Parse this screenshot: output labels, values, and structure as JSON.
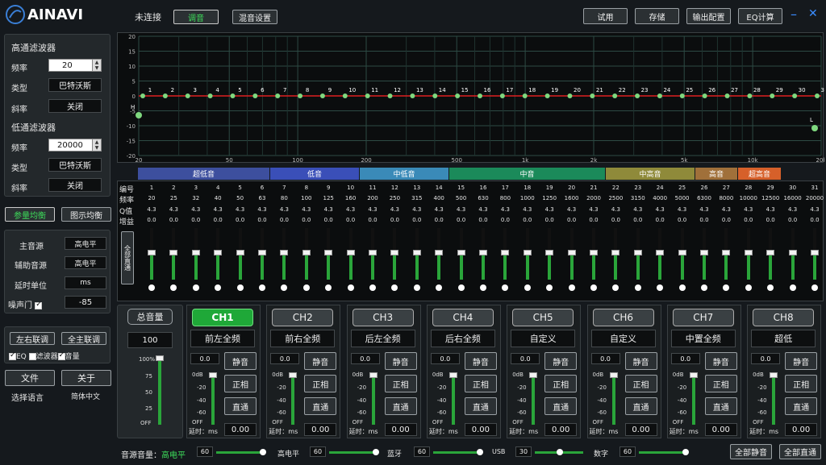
{
  "app": {
    "logo": "AINAVI",
    "status": "未连接",
    "tab1": "调音",
    "tab2": "混音设置"
  },
  "top_buttons": [
    "试用",
    "存储",
    "输出配置",
    "EQ计算"
  ],
  "hp": {
    "title": "高通滤波器",
    "freq_label": "频率",
    "freq": "20",
    "type_label": "类型",
    "type": "巴特沃斯",
    "slope_label": "斜率",
    "slope": "关闭"
  },
  "lp": {
    "title": "低通滤波器",
    "freq_label": "频率",
    "freq": "20000",
    "type_label": "类型",
    "type": "巴特沃斯",
    "slope_label": "斜率",
    "slope": "关闭"
  },
  "eq_mode": {
    "param": "参量均衡",
    "graphic": "图示均衡"
  },
  "source": {
    "main_label": "主音源",
    "main": "高电平",
    "aux_label": "辅助音源",
    "aux": "高电平",
    "delay_label": "延时单位",
    "delay": "ms",
    "noise_label": "噪声门",
    "noise": "-85"
  },
  "link": {
    "lr": "左右联调",
    "all": "全主联调",
    "eq": "EQ",
    "filter": "滤波器",
    "volume": "音量"
  },
  "file": {
    "file": "文件",
    "about": "关于",
    "lang": "选择语言",
    "sub": "简体中文"
  },
  "graph": {
    "y_ticks": [
      "20",
      "15",
      "10",
      "5",
      "0",
      "-5",
      "-10",
      "-15",
      "-20"
    ],
    "x_ticks": [
      "20",
      "50",
      "100",
      "200",
      "500",
      "1k",
      "2k",
      "5k",
      "10k",
      "20k"
    ],
    "hl": "H",
    "ll": "L"
  },
  "bands": [
    {
      "label": "超低音",
      "color": "#3d4f9e"
    },
    {
      "label": "低音",
      "color": "#3a4fb8"
    },
    {
      "label": "中低音",
      "color": "#3a8ab8"
    },
    {
      "label": "中音",
      "color": "#1b8a5a"
    },
    {
      "label": "中高音",
      "color": "#8f8a3a"
    },
    {
      "label": "高音",
      "color": "#a0703a"
    },
    {
      "label": "超高音",
      "color": "#d6602a"
    }
  ],
  "eq_labels": {
    "num": "编号",
    "freq": "频率",
    "q": "Q值",
    "gain": "增益",
    "reset": "全部直通"
  },
  "eq_freq": [
    "20",
    "25",
    "32",
    "40",
    "50",
    "63",
    "80",
    "100",
    "125",
    "160",
    "200",
    "250",
    "315",
    "400",
    "500",
    "630",
    "800",
    "1000",
    "1250",
    "1600",
    "2000",
    "2500",
    "3150",
    "4000",
    "5000",
    "6300",
    "8000",
    "10000",
    "12500",
    "16000",
    "20000"
  ],
  "eq_q": "4.3",
  "eq_gain": "0.0",
  "master": {
    "label": "总音量",
    "value": "100",
    "ticks": [
      "100%",
      "75",
      "50",
      "25",
      "OFF"
    ]
  },
  "channels": [
    {
      "id": "CH1",
      "name": "前左全频"
    },
    {
      "id": "CH2",
      "name": "前右全频"
    },
    {
      "id": "CH3",
      "name": "后左全频"
    },
    {
      "id": "CH4",
      "name": "后右全频"
    },
    {
      "id": "CH5",
      "name": "自定义"
    },
    {
      "id": "CH6",
      "name": "自定义"
    },
    {
      "id": "CH7",
      "name": "中置全频"
    },
    {
      "id": "CH8",
      "name": "超低"
    }
  ],
  "ch_common": {
    "gain": "0.0",
    "mute": "静音",
    "phase": "正相",
    "bypass": "直通",
    "delay_label": "延时：ms",
    "delay": "0.00",
    "ticks": [
      "0dB",
      "-20",
      "-40",
      "-60",
      "OFF"
    ]
  },
  "bottom": {
    "src_label": "音源音量：",
    "src_val": "高电平",
    "hi": "高电平",
    "hi_val": "60",
    "bt": "蓝牙",
    "bt_val": "60",
    "aux": "高电平",
    "aux_val": "60",
    "usb": "USB",
    "usb_val": "30",
    "digital": "数字",
    "dig_val": "60",
    "mute_all": "全部静音",
    "pass_all": "全部直通"
  }
}
